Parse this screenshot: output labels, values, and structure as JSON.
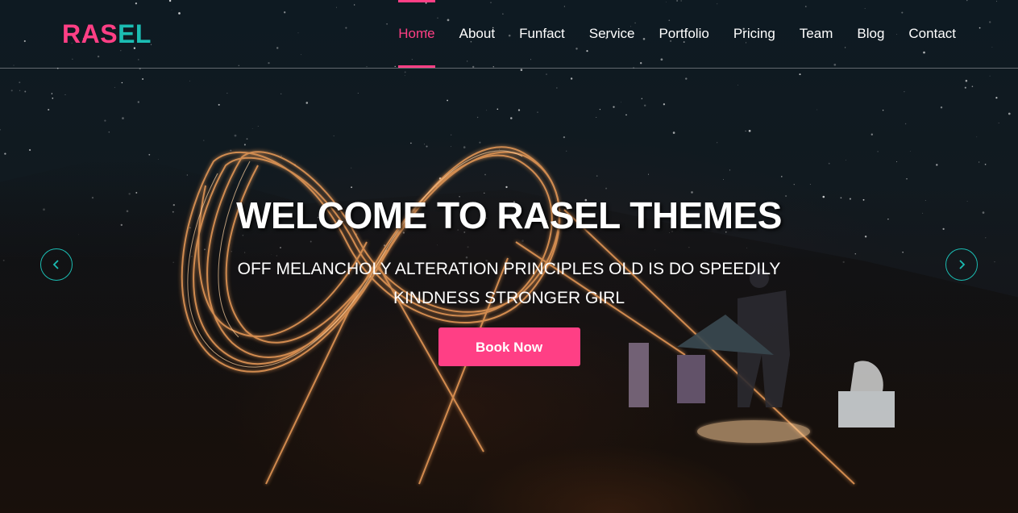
{
  "brand": {
    "part1": "RAS",
    "part2": "EL"
  },
  "nav": {
    "items": [
      {
        "label": "Home",
        "active": true
      },
      {
        "label": "About"
      },
      {
        "label": "Funfact"
      },
      {
        "label": "Service"
      },
      {
        "label": "Portfolio"
      },
      {
        "label": "Pricing"
      },
      {
        "label": "Team"
      },
      {
        "label": "Blog"
      },
      {
        "label": "Contact"
      }
    ]
  },
  "slide": {
    "title": "WELCOME TO RASEL THEMES",
    "subtitle_line1": "OFF MELANCHOLY ALTERATION PRINCIPLES OLD IS DO SPEEDILY",
    "subtitle_line2": "KINDNESS STRONGER GIRL",
    "button_label": "Book Now"
  },
  "carousel": {
    "prev_icon": "chevron-left-icon",
    "next_icon": "chevron-right-icon"
  },
  "colors": {
    "accent_pink": "#ff3f85",
    "accent_teal": "#1bbdb3"
  }
}
